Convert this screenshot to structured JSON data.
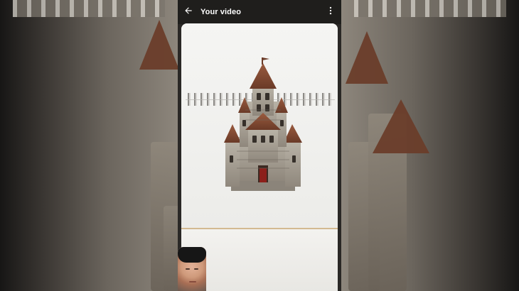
{
  "app": {
    "title": "Your video"
  },
  "colors": {
    "appbar_bg": "#1f1e1c",
    "appbar_text": "#ffffff"
  },
  "icons": {
    "back": "arrow-left-icon",
    "more": "more-vertical-icon"
  }
}
